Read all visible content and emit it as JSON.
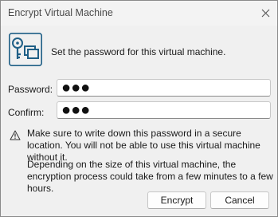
{
  "window": {
    "title": "Encrypt Virtual Machine"
  },
  "icons": {
    "close": "close-icon",
    "key": "key-vm-icon",
    "warning": "warning-icon"
  },
  "intro_text": "Set the password for this virtual machine.",
  "password": {
    "label": "Password:",
    "value": "●●●"
  },
  "confirm": {
    "label": "Confirm:",
    "value": "●●●"
  },
  "warning_text": "Make sure to write down this password in a secure location. You will not be able to use this virtual machine without it.",
  "info_text": "Depending on the size of this virtual machine, the encryption process could take from a few minutes to a few hours.",
  "buttons": {
    "encrypt": "Encrypt",
    "cancel": "Cancel"
  },
  "colors": {
    "icon_blue": "#1f5f86",
    "dialog_bg": "#f0f0f0"
  }
}
